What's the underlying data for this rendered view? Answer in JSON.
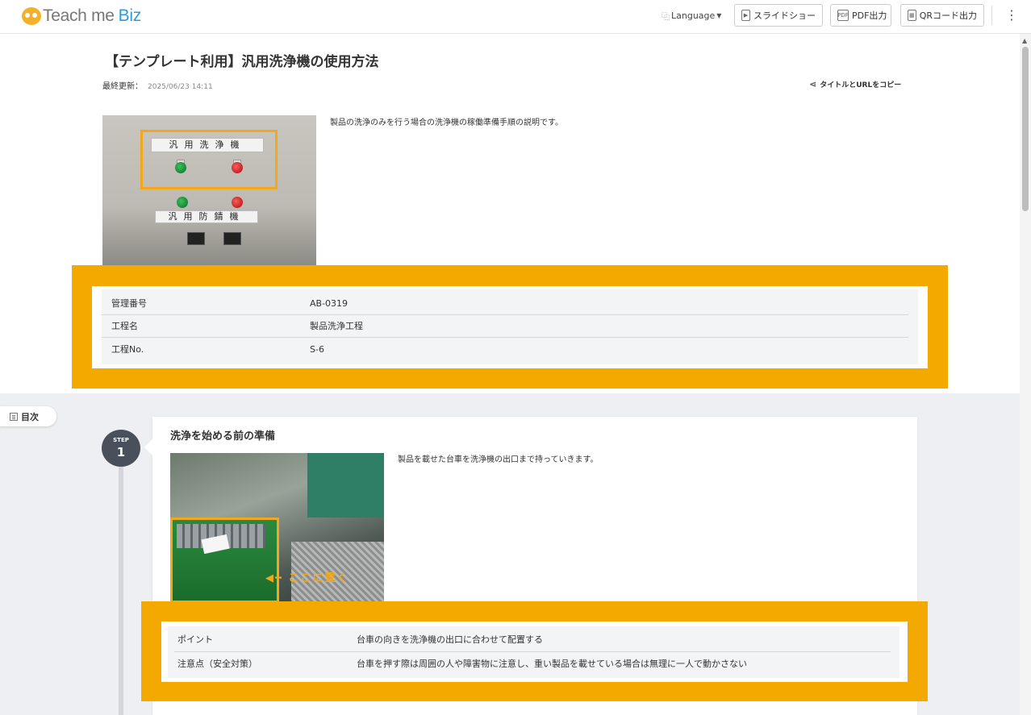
{
  "header": {
    "logo_text": "Teach me",
    "logo_biz": "Biz",
    "language_label": "Language",
    "buttons": {
      "slideshow": "スライドショー",
      "pdf": "PDF出力",
      "pdf_icon": "PDF",
      "qr": "QRコード出力"
    }
  },
  "page": {
    "title": "【テンプレート利用】汎用洗浄機の使用方法",
    "updated_label": "最終更新：",
    "updated_date": "2025/06/23 14:11",
    "copy_link": "タイトルとURLをコピー",
    "description": "製品の洗浄のみを行う場合の洗浄機の稼働準備手順の説明です。",
    "photo_labels": {
      "top_panel": "汎用洗浄機",
      "bottom_panel": "汎用防錆機"
    },
    "info": [
      {
        "key": "管理番号",
        "value": "AB-0319"
      },
      {
        "key": "工程名",
        "value": "製品洗浄工程"
      },
      {
        "key": "工程No.",
        "value": "S-6"
      }
    ]
  },
  "toc_label": "目次",
  "step": {
    "badge_label": "STEP",
    "number": "1",
    "title": "洗浄を始める前の準備",
    "description": "製品を載せた台車を洗浄機の出口まで持っていきます。",
    "photo_annotation": "ここに置く",
    "info": [
      {
        "key": "ポイント",
        "value": "台車の向きを洗浄機の出口に合わせて配置する"
      },
      {
        "key": "注意点（安全対策）",
        "value": "台車を押す際は周囲の人や障害物に注意し、重い製品を載せている場合は無理に一人で動かさない"
      }
    ]
  },
  "colors": {
    "accent_orange": "#f4a900",
    "logo_blue": "#2d9bd6",
    "step_badge": "#4a4f5c",
    "section_bg": "#eeeff2"
  }
}
